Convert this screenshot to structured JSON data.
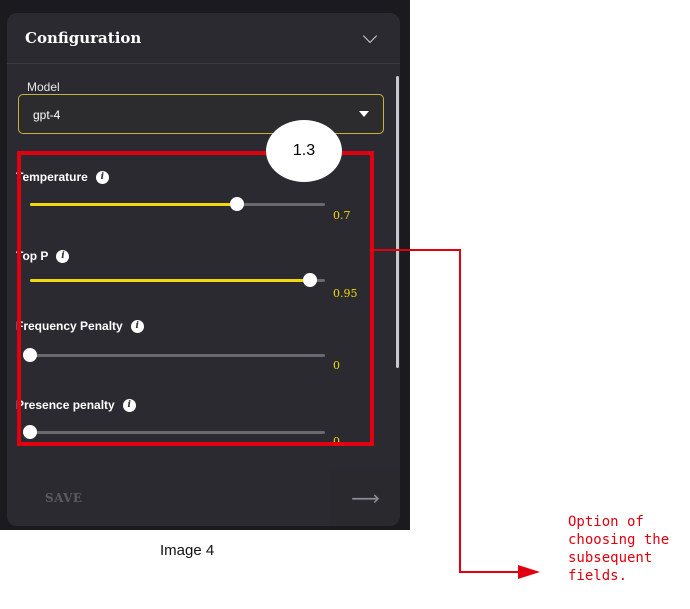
{
  "config": {
    "title": "Configuration",
    "model_label": "Model",
    "model_value": "gpt-4"
  },
  "sliders": [
    {
      "label": "Temperature",
      "value_text": "0.7",
      "fraction": 0.7
    },
    {
      "label": "Top P",
      "value_text": "0.95",
      "fraction": 0.95
    },
    {
      "label": "Frequency Penalty",
      "value_text": "0",
      "fraction": 0
    },
    {
      "label": "Presence penalty",
      "value_text": "0",
      "fraction": 0
    }
  ],
  "footer": {
    "save_label": "SAVE"
  },
  "badge": "1.3",
  "caption": "Image 4",
  "annotation": [
    "Option of",
    "choosing the",
    "subsequent",
    "fields."
  ],
  "colors": {
    "accent": "#f2d90e",
    "highlight": "#e0000f",
    "panel": "#2a2a30"
  }
}
